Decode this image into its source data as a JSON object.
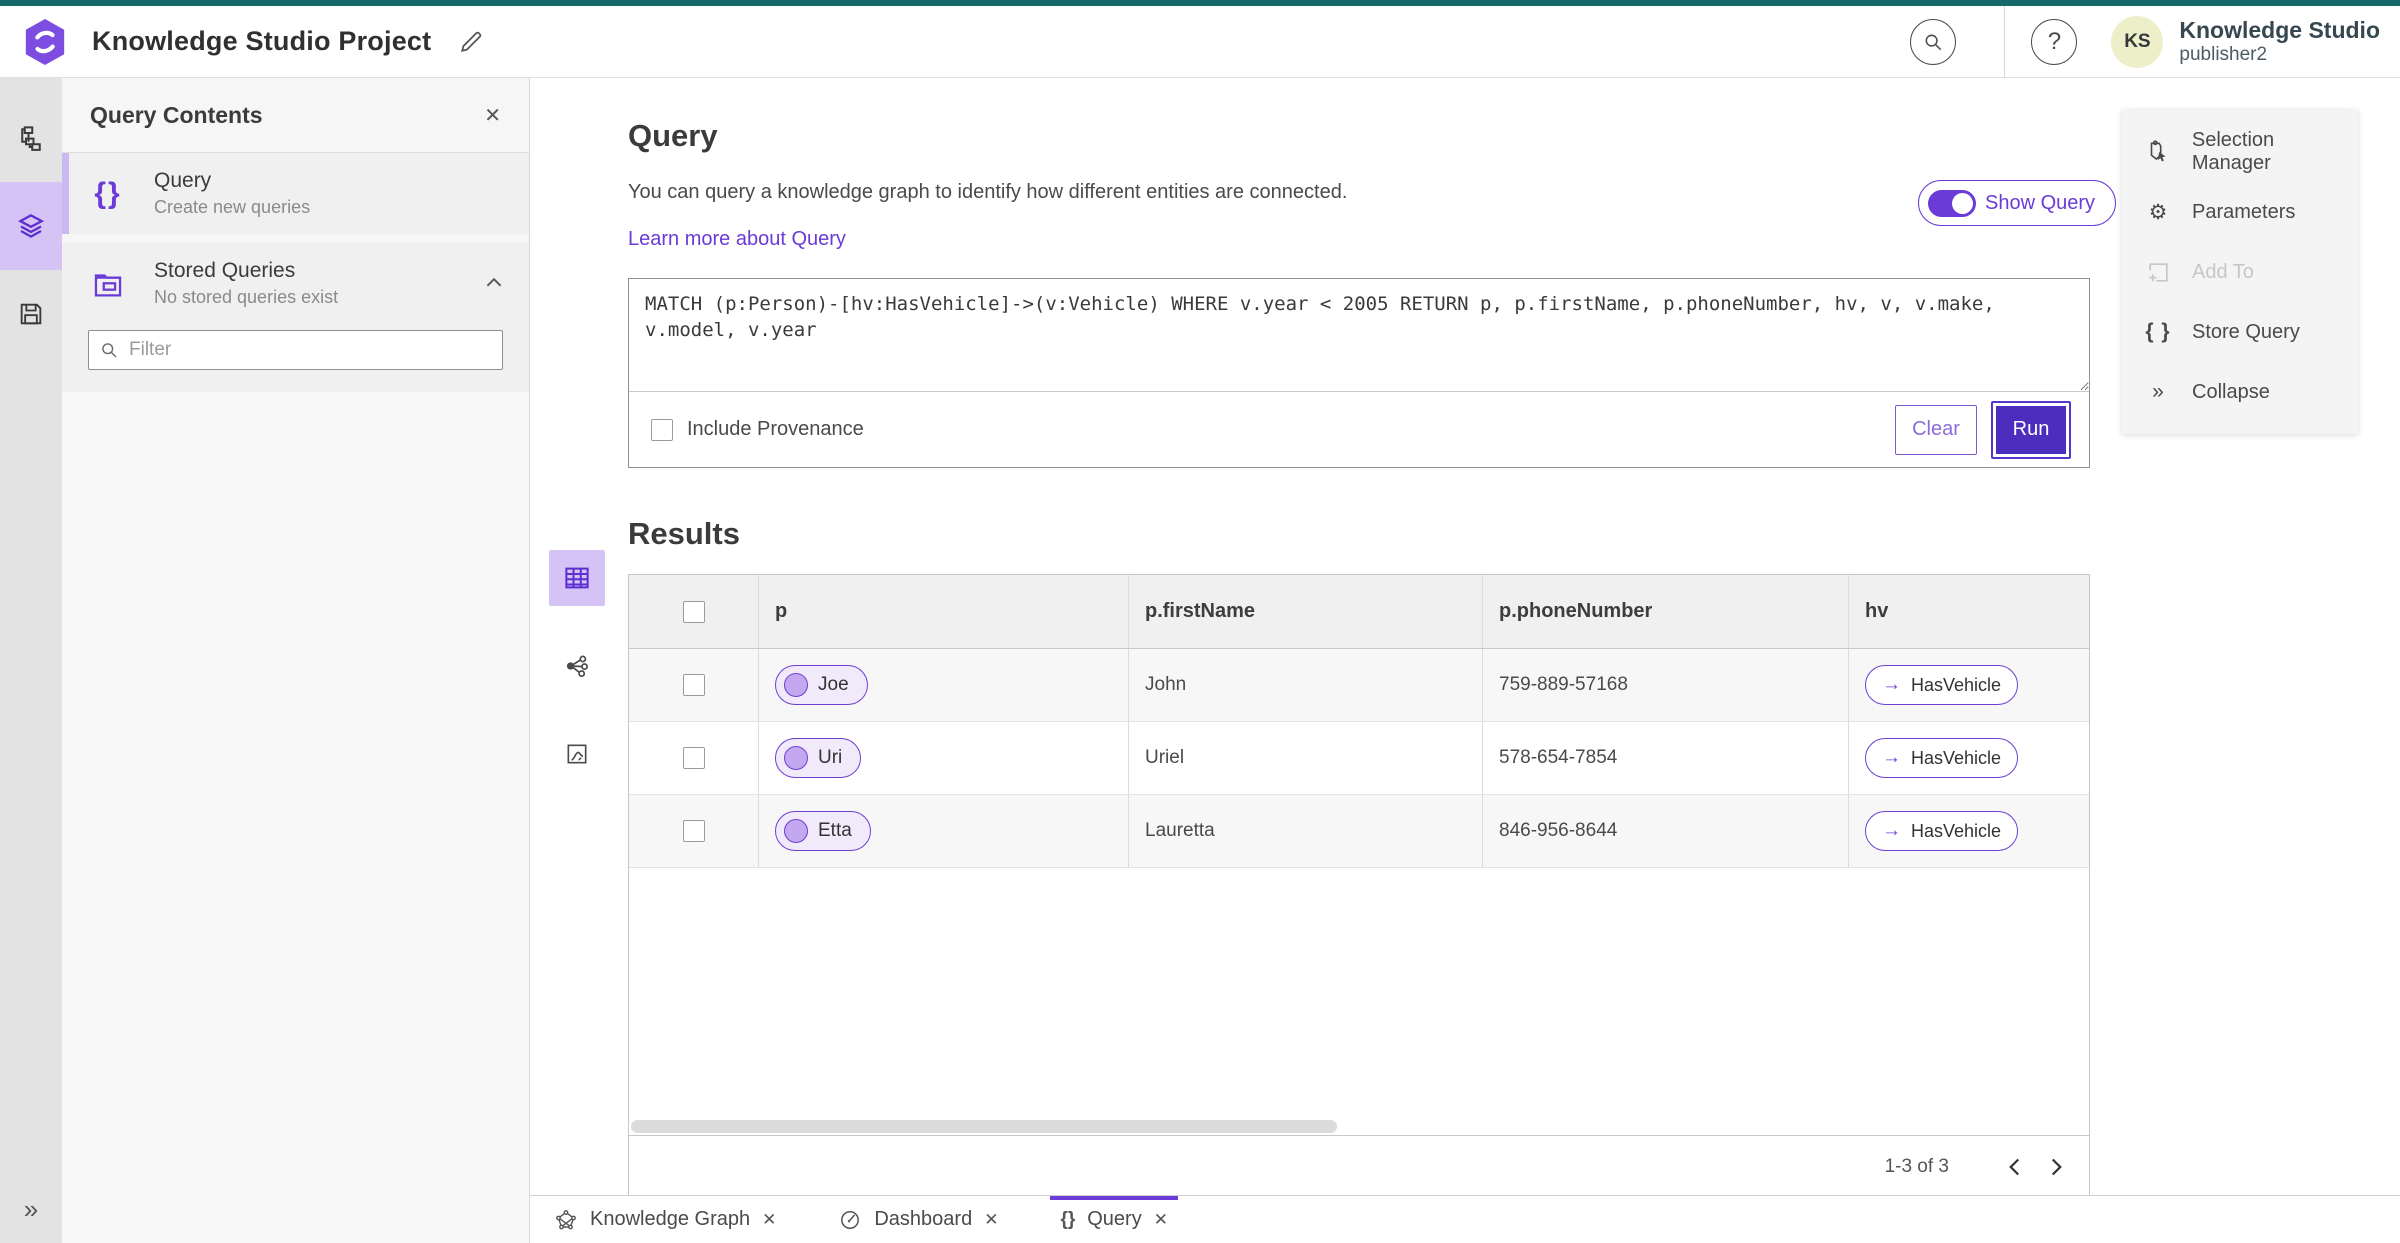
{
  "topbar": {
    "title": "Knowledge Studio Project",
    "user_name": "Knowledge Studio",
    "user_role": "publisher2",
    "avatar_initials": "KS"
  },
  "panel": {
    "title": "Query Contents",
    "items": [
      {
        "title": "Query",
        "subtitle": "Create new queries"
      },
      {
        "title": "Stored Queries",
        "subtitle": "No stored queries exist"
      }
    ],
    "filter_placeholder": "Filter"
  },
  "query": {
    "title": "Query",
    "description": "You can query a knowledge graph to identify how different entities are connected.",
    "link_label": "Learn more about Query",
    "show_query_label": "Show Query",
    "text": "MATCH (p:Person)-[hv:HasVehicle]->(v:Vehicle) WHERE v.year < 2005 RETURN p, p.firstName, p.phoneNumber, hv, v, v.make, v.model, v.year",
    "include_provenance_label": "Include Provenance",
    "clear_label": "Clear",
    "run_label": "Run"
  },
  "results": {
    "title": "Results",
    "columns": [
      "p",
      "p.firstName",
      "p.phoneNumber",
      "hv"
    ],
    "rows": [
      {
        "p": "Joe",
        "firstName": "John",
        "phoneNumber": "759-889-57168",
        "hv": "HasVehicle"
      },
      {
        "p": "Uri",
        "firstName": "Uriel",
        "phoneNumber": "578-654-7854",
        "hv": "HasVehicle"
      },
      {
        "p": "Etta",
        "firstName": "Lauretta",
        "phoneNumber": "846-956-8644",
        "hv": "HasVehicle"
      }
    ],
    "pagination": "1-3 of 3"
  },
  "right_menu": {
    "items": [
      {
        "label": "Selection Manager"
      },
      {
        "label": "Parameters"
      },
      {
        "label": "Add To"
      },
      {
        "label": "Store Query"
      },
      {
        "label": "Collapse"
      }
    ]
  },
  "tabs": [
    {
      "label": "Knowledge Graph"
    },
    {
      "label": "Dashboard"
    },
    {
      "label": "Query"
    }
  ],
  "glyphs": {
    "close": "✕",
    "braces": "{ }",
    "braces_tight": "{}",
    "arrow_right": "→",
    "chevrons_right": "»",
    "gear": "⚙",
    "question": "?"
  },
  "colors": {
    "accent_purple": "#6A3BD6",
    "run_button_purple": "#4B2EBE",
    "selected_icon_bg": "#D6C3F6",
    "top_strip_teal": "#15696B",
    "avatar_bg": "#EDEFC9",
    "pill_node_bg": "#F0EAFB"
  }
}
